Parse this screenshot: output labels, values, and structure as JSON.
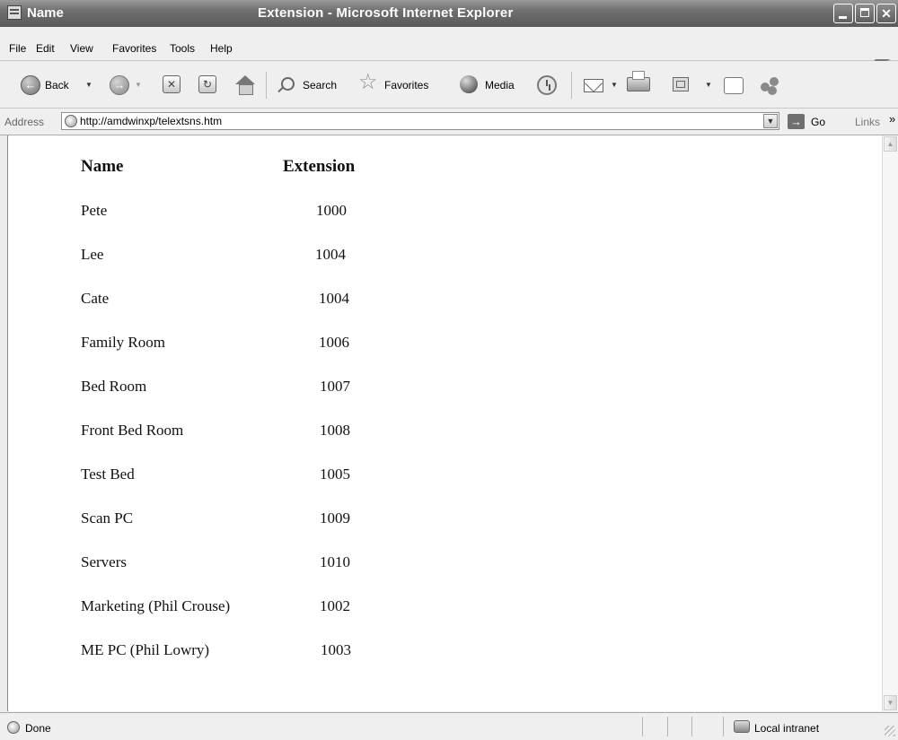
{
  "window": {
    "title_left": "Name",
    "title": "Extension - Microsoft Internet Explorer"
  },
  "menu": {
    "file": "File",
    "edit": "Edit",
    "view": "View",
    "favorites": "Favorites",
    "tools": "Tools",
    "help": "Help"
  },
  "toolbar": {
    "back": "Back",
    "search": "Search",
    "favorites": "Favorites",
    "media": "Media"
  },
  "address": {
    "label": "Address",
    "url": "http://amdwinxp/telextsns.htm",
    "go": "Go",
    "links": "Links"
  },
  "table": {
    "headers": {
      "name": "Name",
      "extension": "Extension"
    },
    "rows": [
      {
        "name": "Pete",
        "extension": "1000"
      },
      {
        "name": "Lee",
        "extension": "1004"
      },
      {
        "name": "Cate",
        "extension": "1004"
      },
      {
        "name": "Family Room",
        "extension": "1006"
      },
      {
        "name": "Bed Room",
        "extension": "1007"
      },
      {
        "name": "Front Bed Room",
        "extension": "1008"
      },
      {
        "name": "Test Bed",
        "extension": "1005"
      },
      {
        "name": "Scan PC",
        "extension": "1009"
      },
      {
        "name": "Servers",
        "extension": "1010"
      },
      {
        "name": "Marketing (Phil Crouse)",
        "extension": "1002"
      },
      {
        "name": "ME PC (Phil Lowry)",
        "extension": "1003"
      }
    ]
  },
  "status": {
    "text": "Done",
    "zone": "Local intranet"
  }
}
